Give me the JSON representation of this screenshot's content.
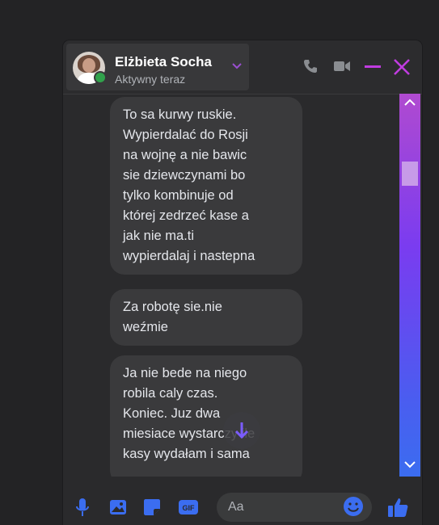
{
  "contact": {
    "name": "Elżbieta Socha",
    "status": "Aktywny teraz"
  },
  "messages": [
    {
      "lines": [
        "To sa kurwy ruskie.",
        "Wypierdalać do Rosji",
        "na wojnę a nie bawic",
        "sie dziewczynami bo",
        "tylko kombinuje od",
        "której zedrzeć kase a",
        "jak nie ma.ti",
        "wypierdalaj i nastepna"
      ]
    },
    {
      "lines": [
        "Za robotę sie.nie",
        "weźmie"
      ]
    },
    {
      "lines": [
        "Ja nie bede na niego",
        "robila caly czas.",
        "Koniec. Juz dwa",
        "miesiace wystarczy ile",
        "kasy wydałam i sama"
      ]
    }
  ],
  "composer": {
    "placeholder": "Aa"
  },
  "icons": {
    "header": [
      "phone-icon",
      "video-icon",
      "minimize-icon",
      "close-icon",
      "chevron-down-icon"
    ],
    "composer": [
      "mic-icon",
      "image-icon",
      "sticker-icon",
      "gif-icon",
      "emoji-icon",
      "thumbs-up-icon"
    ]
  },
  "colors": {
    "accent": "#b04ad0",
    "scrollbar_bottom": "#3b6df0",
    "online": "#31a24c",
    "bubble": "#3a3a3c"
  }
}
